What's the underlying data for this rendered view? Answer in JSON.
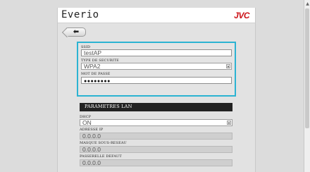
{
  "header": {
    "app_title": "Everio",
    "brand": "JVC"
  },
  "nav": {
    "back_icon": "⬅"
  },
  "wifi": {
    "ssid_label": "SSID",
    "ssid_value": "testAP",
    "security_label": "TYPE DE SECURITE",
    "security_value": "WPA2",
    "password_label": "MOT DE PASSE",
    "password_value": "●●●●●●●●"
  },
  "lan": {
    "title": "PARAMETRES LAN",
    "dhcp_label": "DHCP",
    "dhcp_value": "ON",
    "ip_label": "ADRESSE IP",
    "ip_value": "0.0.0.0",
    "mask_label": "MASQUE SOUS-RESEAU",
    "mask_value": "0.0.0.0",
    "gateway_label": "PASSERELLE DEFAUT",
    "gateway_value": "0.0.0.0"
  },
  "colors": {
    "accent": "#2cb3d2",
    "brand": "#cc1016",
    "section_bg": "#222222"
  }
}
